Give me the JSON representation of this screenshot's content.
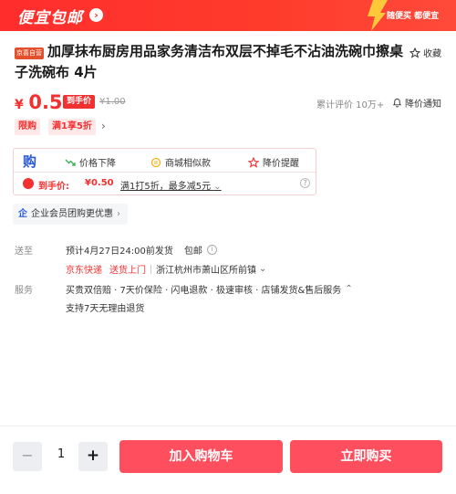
{
  "banner": {
    "title": "便宜包邮",
    "tagline": "随便买 都便宜",
    "bg_color": "#ff2d2d"
  },
  "product": {
    "badge": "京喜自营",
    "title_line1": "加厚抹布厨房用品家务清洁布双层不掉毛不沾油洗碗巾擦桌",
    "title_line2": "子洗碗布 4片",
    "favorite_label": "收藏"
  },
  "price": {
    "currency": "¥",
    "value": "0.5",
    "final_tag": "到手价",
    "original": "¥1.00",
    "reviews_label": "累计评价  10万+",
    "notify_label": "降价通知",
    "accent_color": "#f23030"
  },
  "promotions": [
    {
      "label": "限购"
    },
    {
      "label": "满1享5折"
    }
  ],
  "features": {
    "logo": "购",
    "items": [
      {
        "icon": "trend-down-icon",
        "label": "价格下降"
      },
      {
        "icon": "coins-icon",
        "label": "商城相似款"
      },
      {
        "icon": "star-icon",
        "label": "降价提醒"
      }
    ],
    "deal_label": "到手价:",
    "deal_value": "¥0.50",
    "deal_coupon": "满1打5折，最多减5元"
  },
  "enterprise": {
    "label": "企业会员团购更优惠"
  },
  "shipping": {
    "label": "送至",
    "estimate": "预计4月27日24:00前发货",
    "free_ship": "包邮",
    "carrier": "京东快递",
    "delivery": "送货上门",
    "address": "浙江杭州市萧山区所前镇"
  },
  "service": {
    "label": "服务",
    "line1": "买贵双倍赔 · 7天价保险 · 闪电退款 · 极速审核 · 店铺发货&售后服务",
    "line2": "支持7天无理由退货"
  },
  "cart": {
    "quantity": "1",
    "minus": "−",
    "plus": "+",
    "add_to_cart": "加入购物车",
    "buy_now": "立即购买",
    "button_color": "#ff4f5f"
  }
}
